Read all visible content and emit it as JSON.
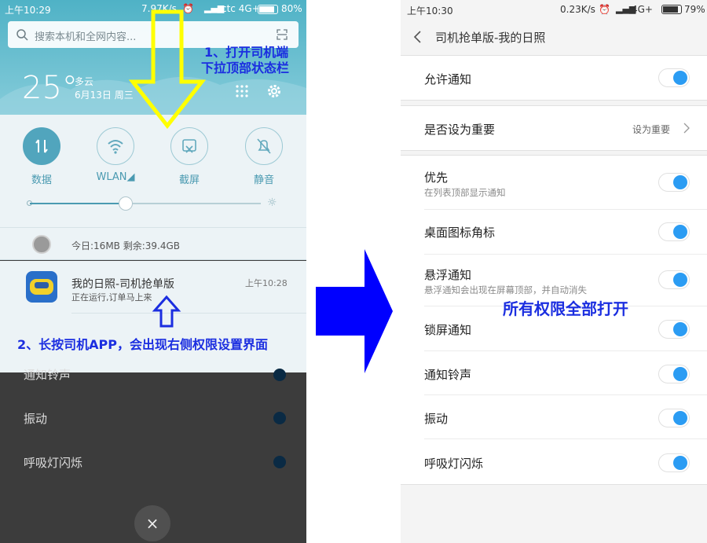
{
  "left_phone": {
    "status": {
      "time": "上午10:29",
      "speed": "7.97K/s",
      "carrier": "ctc 4G+",
      "battery": "80%"
    },
    "search": {
      "placeholder": "搜索本机和全网内容..."
    },
    "weather": {
      "temp": "25°",
      "condition": "多云",
      "date": "6月13日 周三"
    },
    "quick_settings": [
      {
        "label": "数据",
        "icon": "data-icon",
        "active": true
      },
      {
        "label": "WLAN◢",
        "icon": "wifi-icon",
        "active": false
      },
      {
        "label": "截屏",
        "icon": "screenshot-icon",
        "active": false
      },
      {
        "label": "静音",
        "icon": "mute-icon",
        "active": false
      }
    ],
    "brightness": 0.42,
    "storage": "今日:16MB   剩余:39.4GB",
    "notification": {
      "title": "我的日照-司机抢单版",
      "subtitle": "正在运行,订单马上来",
      "time": "上午10:28"
    },
    "dim_rows": [
      "通知铃声",
      "振动",
      "呼吸灯闪烁"
    ],
    "close_label": "×"
  },
  "annotations": {
    "step1_line1": "1、打开司机端",
    "step1_line2": "下拉顶部状态栏",
    "step2": "2、长按司机APP，会出现右侧权限设置界面",
    "step3": "所有权限全部打开"
  },
  "colors": {
    "annotation": "#1b2ee0",
    "arrow_yellow": "#ffff00",
    "arrow_blue": "#0000ff",
    "toggle_on": "#2b9cf3",
    "tile_active": "#51a5bd"
  },
  "right_phone": {
    "status": {
      "time": "上午10:30",
      "speed": "0.23K/s",
      "carrier": "4G+",
      "battery": "79%"
    },
    "title": "司机抢单版-我的日照",
    "allow_notifications": "允许通知",
    "importance": {
      "label": "是否设为重要",
      "value": "设为重要"
    },
    "settings": [
      {
        "label": "优先",
        "sub": "在列表顶部显示通知",
        "on": true
      },
      {
        "label": "桌面图标角标",
        "sub": "",
        "on": true
      },
      {
        "label": "悬浮通知",
        "sub": "悬浮通知会出现在屏幕顶部，并自动消失",
        "on": true
      },
      {
        "label": "锁屏通知",
        "sub": "",
        "on": true
      },
      {
        "label": "通知铃声",
        "sub": "",
        "on": true
      },
      {
        "label": "振动",
        "sub": "",
        "on": true
      },
      {
        "label": "呼吸灯闪烁",
        "sub": "",
        "on": true
      }
    ]
  }
}
